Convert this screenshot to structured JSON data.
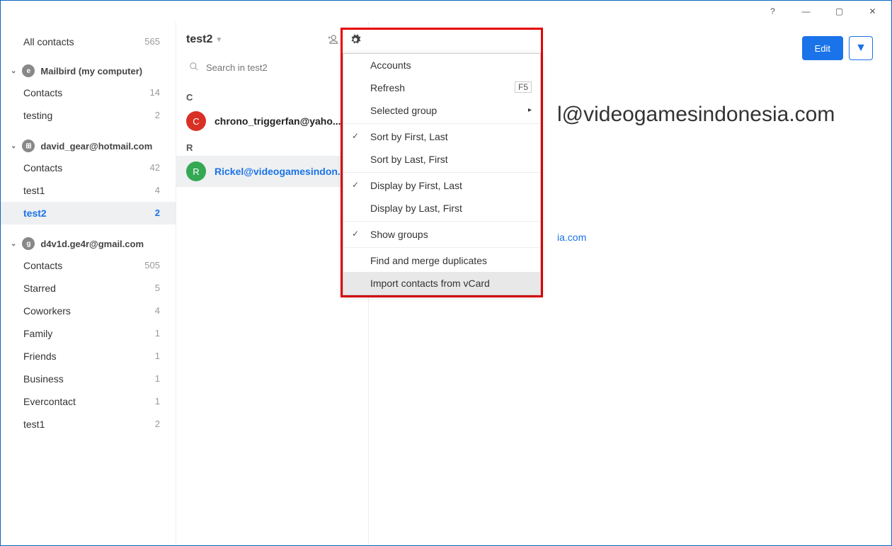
{
  "titlebar": {
    "help": "?",
    "min": "—",
    "max": "▢",
    "close": "✕"
  },
  "sidebar": {
    "all_label": "All contacts",
    "all_count": "565",
    "accounts": [
      {
        "name": "Mailbird (my computer)",
        "icon": "e",
        "items": [
          {
            "label": "Contacts",
            "count": "14"
          },
          {
            "label": "testing",
            "count": "2"
          }
        ]
      },
      {
        "name": "david_gear@hotmail.com",
        "icon": "⊞",
        "items": [
          {
            "label": "Contacts",
            "count": "42"
          },
          {
            "label": "test1",
            "count": "4"
          },
          {
            "label": "test2",
            "count": "2",
            "active": true
          }
        ]
      },
      {
        "name": "d4v1d.ge4r@gmail.com",
        "icon": "g",
        "items": [
          {
            "label": "Contacts",
            "count": "505"
          },
          {
            "label": "Starred",
            "count": "5"
          },
          {
            "label": "Coworkers",
            "count": "4"
          },
          {
            "label": "Family",
            "count": "1"
          },
          {
            "label": "Friends",
            "count": "1"
          },
          {
            "label": "Business",
            "count": "1"
          },
          {
            "label": "Evercontact",
            "count": "1"
          },
          {
            "label": "test1",
            "count": "2"
          }
        ]
      }
    ]
  },
  "mid": {
    "title": "test2",
    "search_placeholder": "Search in test2",
    "sections": [
      {
        "letter": "C",
        "contacts": [
          {
            "initial": "C",
            "color": "red",
            "name": "chrono_triggerfan@yaho..."
          }
        ]
      },
      {
        "letter": "R",
        "contacts": [
          {
            "initial": "R",
            "color": "green",
            "name": "Rickel@videogamesindon...",
            "selected": true
          }
        ]
      }
    ]
  },
  "detail": {
    "edit_label": "Edit",
    "big_email": "l@videogamesindonesia.com",
    "small_email": "ia.com"
  },
  "menu": {
    "items": [
      {
        "label": "Accounts"
      },
      {
        "label": "Refresh",
        "shortcut": "F5"
      },
      {
        "label": "Selected group",
        "submenu": true
      },
      {
        "sep": true
      },
      {
        "label": "Sort by First, Last",
        "checked": true
      },
      {
        "label": "Sort by Last, First"
      },
      {
        "sep": true
      },
      {
        "label": "Display by First, Last",
        "checked": true
      },
      {
        "label": "Display by Last, First"
      },
      {
        "sep": true
      },
      {
        "label": "Show groups",
        "checked": true
      },
      {
        "sep": true
      },
      {
        "label": "Find and merge duplicates"
      },
      {
        "label": "Import contacts from vCard",
        "hover": true
      }
    ]
  }
}
